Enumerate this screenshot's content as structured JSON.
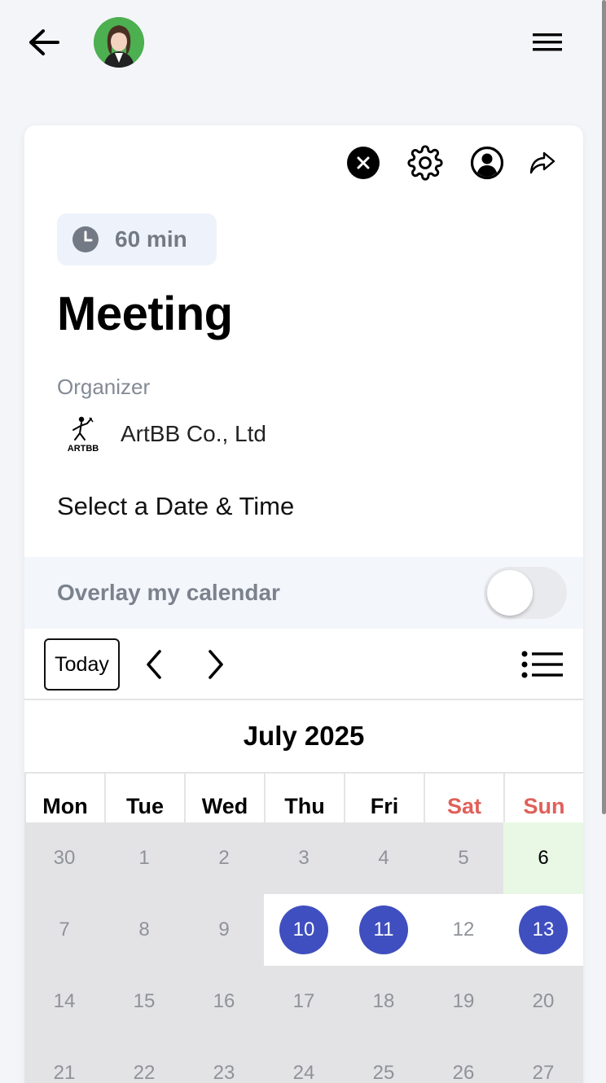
{
  "header": {
    "back_icon": "arrow-left-icon",
    "avatar": "profile-photo",
    "menu_icon": "hamburger-menu-icon"
  },
  "card": {
    "action_icons": [
      "close-circle-icon",
      "gear-icon",
      "user-circle-icon",
      "share-arrow-icon"
    ],
    "duration": "60 min",
    "title": "Meeting",
    "organizer_label": "Organizer",
    "organizer_logo_text": "ARTBB",
    "organizer_name": "ArtBB Co., Ltd",
    "select_prompt": "Select a Date & Time",
    "overlay_label": "Overlay my calendar",
    "overlay_enabled": false
  },
  "calendar": {
    "today_label": "Today",
    "month_title": "July 2025",
    "weekdays": [
      "Mon",
      "Tue",
      "Wed",
      "Thu",
      "Fri",
      "Sat",
      "Sun"
    ],
    "weeks": [
      [
        "30",
        "1",
        "2",
        "3",
        "4",
        "5",
        "6"
      ],
      [
        "7",
        "8",
        "9",
        "10",
        "11",
        "12",
        "13"
      ],
      [
        "14",
        "15",
        "16",
        "17",
        "18",
        "19",
        "20"
      ],
      [
        "21",
        "22",
        "23",
        "24",
        "25",
        "26",
        "27"
      ]
    ],
    "colors": {
      "available_circle": "#3f4fbf",
      "weekend_header": "#e0605a",
      "today_bg": "#e9f8e4",
      "unavailable_bg": "#e3e3e6"
    }
  }
}
